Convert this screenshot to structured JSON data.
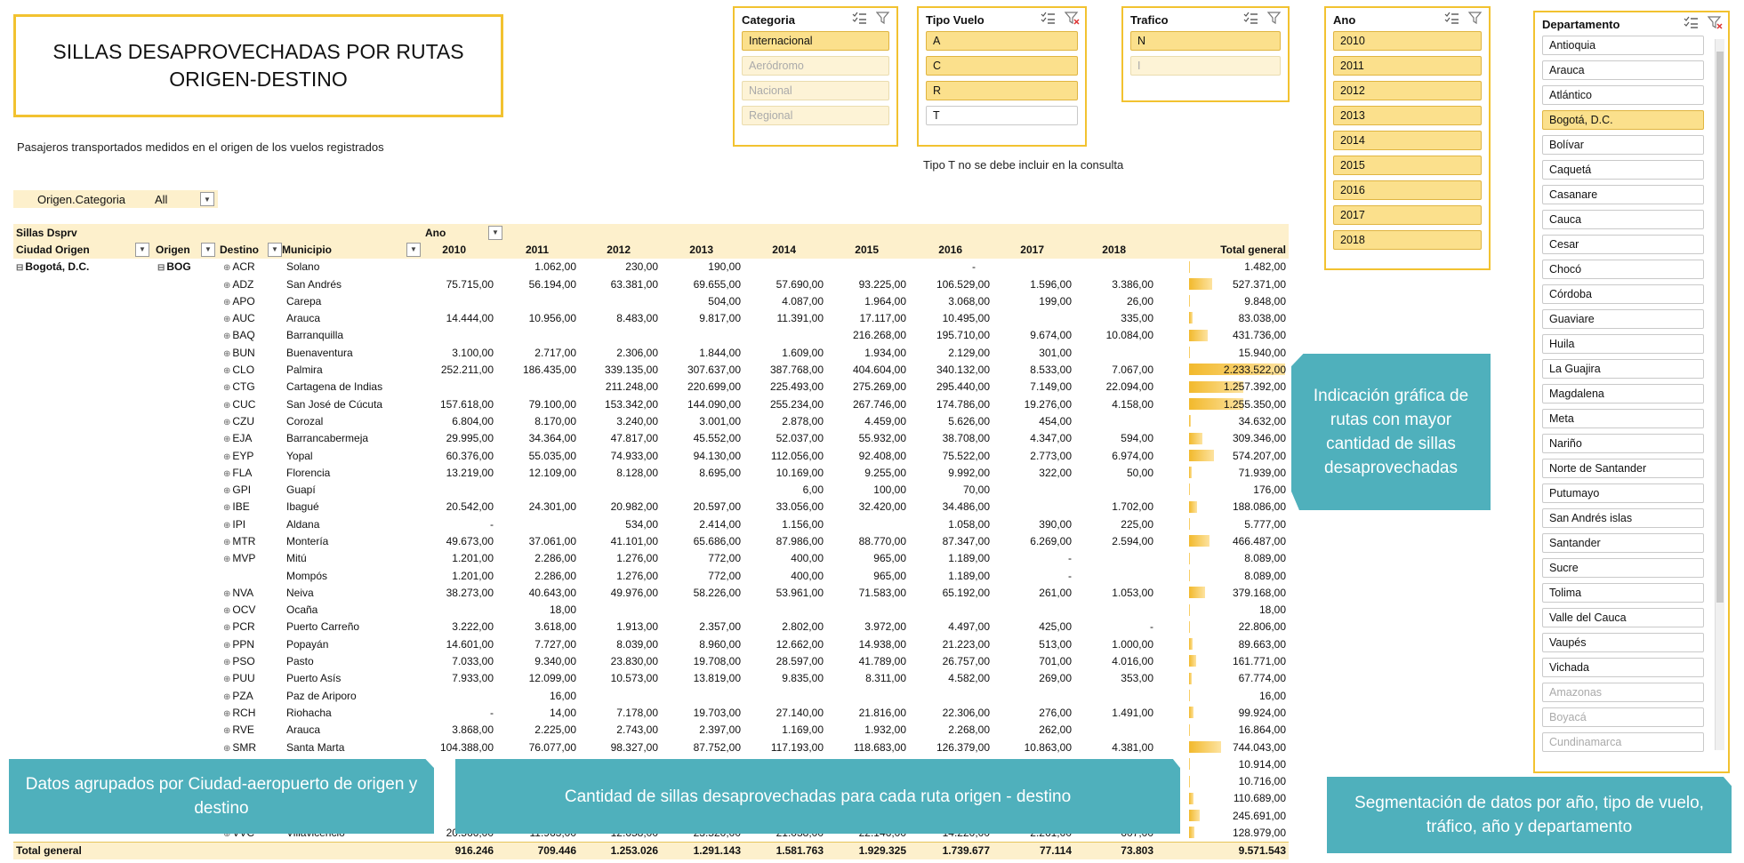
{
  "title": "SILLAS DESAPROVECHADAS POR RUTAS ORIGEN-DESTINO",
  "subtitle": "Pasajeros transportados medidos en el origen de los vuelos registrados",
  "note_tipo": "Tipo T no se debe incluir en la consulta",
  "slicers": {
    "categoria": {
      "title": "Categoria",
      "items": [
        {
          "label": "Internacional",
          "state": "sel"
        },
        {
          "label": "Aeródromo",
          "state": "dim"
        },
        {
          "label": "Nacional",
          "state": "dim"
        },
        {
          "label": "Regional",
          "state": "dim"
        }
      ]
    },
    "tipo_vuelo": {
      "title": "Tipo Vuelo",
      "items": [
        {
          "label": "A",
          "state": "sel"
        },
        {
          "label": "C",
          "state": "sel"
        },
        {
          "label": "R",
          "state": "sel"
        },
        {
          "label": "T",
          "state": ""
        }
      ]
    },
    "trafico": {
      "title": "Trafico",
      "items": [
        {
          "label": "N",
          "state": "sel"
        },
        {
          "label": "I",
          "state": "dim"
        }
      ]
    },
    "ano": {
      "title": "Ano",
      "items": [
        {
          "label": "2010",
          "state": "sel"
        },
        {
          "label": "2011",
          "state": "sel"
        },
        {
          "label": "2012",
          "state": "sel"
        },
        {
          "label": "2013",
          "state": "sel"
        },
        {
          "label": "2014",
          "state": "sel"
        },
        {
          "label": "2015",
          "state": "sel"
        },
        {
          "label": "2016",
          "state": "sel"
        },
        {
          "label": "2017",
          "state": "sel"
        },
        {
          "label": "2018",
          "state": "sel"
        }
      ]
    },
    "departamento": {
      "title": "Departamento",
      "items": [
        {
          "label": "Antioquia",
          "state": ""
        },
        {
          "label": "Arauca",
          "state": ""
        },
        {
          "label": "Atlántico",
          "state": ""
        },
        {
          "label": "Bogotá, D.C.",
          "state": "sel"
        },
        {
          "label": "Bolívar",
          "state": ""
        },
        {
          "label": "Caquetá",
          "state": ""
        },
        {
          "label": "Casanare",
          "state": ""
        },
        {
          "label": "Cauca",
          "state": ""
        },
        {
          "label": "Cesar",
          "state": ""
        },
        {
          "label": "Chocó",
          "state": ""
        },
        {
          "label": "Córdoba",
          "state": ""
        },
        {
          "label": "Guaviare",
          "state": ""
        },
        {
          "label": "Huila",
          "state": ""
        },
        {
          "label": "La Guajira",
          "state": ""
        },
        {
          "label": "Magdalena",
          "state": ""
        },
        {
          "label": "Meta",
          "state": ""
        },
        {
          "label": "Nariño",
          "state": ""
        },
        {
          "label": "Norte de Santander",
          "state": ""
        },
        {
          "label": "Putumayo",
          "state": ""
        },
        {
          "label": "San Andrés islas",
          "state": ""
        },
        {
          "label": "Santander",
          "state": ""
        },
        {
          "label": "Sucre",
          "state": ""
        },
        {
          "label": "Tolima",
          "state": ""
        },
        {
          "label": "Valle del Cauca",
          "state": ""
        },
        {
          "label": "Vaupés",
          "state": ""
        },
        {
          "label": "Vichada",
          "state": ""
        },
        {
          "label": "Amazonas",
          "state": "off"
        },
        {
          "label": "Boyacá",
          "state": "off"
        },
        {
          "label": "Cundinamarca",
          "state": "off"
        }
      ]
    }
  },
  "filter": {
    "label": "Origen.Categoria",
    "value": "All"
  },
  "pivot": {
    "measure": "Sillas Dsprv",
    "col_field": "Ano",
    "headers": [
      "Ciudad Origen",
      "Origen",
      "Destino",
      "Municipio"
    ],
    "years": [
      "2010",
      "2011",
      "2012",
      "2013",
      "2014",
      "2015",
      "2016",
      "2017",
      "2018"
    ],
    "total_label": "Total general",
    "city": "Bogotá, D.C.",
    "origin": "BOG",
    "max_total": 2233522,
    "rows": [
      {
        "d": "ACR",
        "m": "Solano",
        "v": [
          "",
          "1.062,00",
          "230,00",
          "190,00",
          "",
          "",
          "-",
          "",
          ""
        ],
        "t": "1.482,00",
        "n": 1482
      },
      {
        "d": "ADZ",
        "m": "San Andrés",
        "v": [
          "75.715,00",
          "56.194,00",
          "63.381,00",
          "69.655,00",
          "57.690,00",
          "93.225,00",
          "106.529,00",
          "1.596,00",
          "3.386,00"
        ],
        "t": "527.371,00",
        "n": 527371
      },
      {
        "d": "APO",
        "m": "Carepa",
        "v": [
          "",
          "",
          "",
          "504,00",
          "4.087,00",
          "1.964,00",
          "3.068,00",
          "199,00",
          "26,00"
        ],
        "t": "9.848,00",
        "n": 9848
      },
      {
        "d": "AUC",
        "m": "Arauca",
        "v": [
          "14.444,00",
          "10.956,00",
          "8.483,00",
          "9.817,00",
          "11.391,00",
          "17.117,00",
          "10.495,00",
          "",
          "335,00"
        ],
        "t": "83.038,00",
        "n": 83038
      },
      {
        "d": "BAQ",
        "m": "Barranquilla",
        "v": [
          "",
          "",
          "",
          "",
          "",
          "216.268,00",
          "195.710,00",
          "9.674,00",
          "10.084,00"
        ],
        "t": "431.736,00",
        "n": 431736
      },
      {
        "d": "BUN",
        "m": "Buenaventura",
        "v": [
          "3.100,00",
          "2.717,00",
          "2.306,00",
          "1.844,00",
          "1.609,00",
          "1.934,00",
          "2.129,00",
          "301,00",
          ""
        ],
        "t": "15.940,00",
        "n": 15940
      },
      {
        "d": "CLO",
        "m": "Palmira",
        "v": [
          "252.211,00",
          "186.435,00",
          "339.135,00",
          "307.637,00",
          "387.768,00",
          "404.604,00",
          "340.132,00",
          "8.533,00",
          "7.067,00"
        ],
        "t": "2.233.522,00",
        "n": 2233522
      },
      {
        "d": "CTG",
        "m": "Cartagena de Indias",
        "v": [
          "",
          "",
          "211.248,00",
          "220.699,00",
          "225.493,00",
          "275.269,00",
          "295.440,00",
          "7.149,00",
          "22.094,00"
        ],
        "t": "1.257.392,00",
        "n": 1257392
      },
      {
        "d": "CUC",
        "m": "San José de Cúcuta",
        "v": [
          "157.618,00",
          "79.100,00",
          "153.342,00",
          "144.090,00",
          "255.234,00",
          "267.746,00",
          "174.786,00",
          "19.276,00",
          "4.158,00"
        ],
        "t": "1.255.350,00",
        "n": 1255350
      },
      {
        "d": "CZU",
        "m": "Corozal",
        "v": [
          "6.804,00",
          "8.170,00",
          "3.240,00",
          "3.001,00",
          "2.878,00",
          "4.459,00",
          "5.626,00",
          "454,00",
          ""
        ],
        "t": "34.632,00",
        "n": 34632
      },
      {
        "d": "EJA",
        "m": "Barrancabermeja",
        "v": [
          "29.995,00",
          "34.364,00",
          "47.817,00",
          "45.552,00",
          "52.037,00",
          "55.932,00",
          "38.708,00",
          "4.347,00",
          "594,00"
        ],
        "t": "309.346,00",
        "n": 309346
      },
      {
        "d": "EYP",
        "m": "Yopal",
        "v": [
          "60.376,00",
          "55.035,00",
          "74.933,00",
          "94.130,00",
          "112.056,00",
          "92.408,00",
          "75.522,00",
          "2.773,00",
          "6.974,00"
        ],
        "t": "574.207,00",
        "n": 574207
      },
      {
        "d": "FLA",
        "m": "Florencia",
        "v": [
          "13.219,00",
          "12.109,00",
          "8.128,00",
          "8.695,00",
          "10.169,00",
          "9.255,00",
          "9.992,00",
          "322,00",
          "50,00"
        ],
        "t": "71.939,00",
        "n": 71939
      },
      {
        "d": "GPI",
        "m": "Guapí",
        "v": [
          "",
          "",
          "",
          "",
          "6,00",
          "100,00",
          "70,00",
          "",
          ""
        ],
        "t": "176,00",
        "n": 176
      },
      {
        "d": "IBE",
        "m": "Ibagué",
        "v": [
          "20.542,00",
          "24.301,00",
          "20.982,00",
          "20.597,00",
          "33.056,00",
          "32.420,00",
          "34.486,00",
          "",
          "1.702,00"
        ],
        "t": "188.086,00",
        "n": 188086
      },
      {
        "d": "IPI",
        "m": "Aldana",
        "v": [
          "-",
          "",
          "534,00",
          "2.414,00",
          "1.156,00",
          "",
          "1.058,00",
          "390,00",
          "225,00"
        ],
        "t": "5.777,00",
        "n": 5777
      },
      {
        "d": "MTR",
        "m": "Montería",
        "v": [
          "49.673,00",
          "37.061,00",
          "41.101,00",
          "65.686,00",
          "87.986,00",
          "88.770,00",
          "87.347,00",
          "6.269,00",
          "2.594,00"
        ],
        "t": "466.487,00",
        "n": 466487
      },
      {
        "d": "MVP",
        "m": "Mitú",
        "v": [
          "1.201,00",
          "2.286,00",
          "1.276,00",
          "772,00",
          "400,00",
          "965,00",
          "1.189,00",
          "-",
          ""
        ],
        "t": "8.089,00",
        "n": 8089
      },
      {
        "d": "",
        "m": "Mompós",
        "v": [
          "1.201,00",
          "2.286,00",
          "1.276,00",
          "772,00",
          "400,00",
          "965,00",
          "1.189,00",
          "-",
          ""
        ],
        "t": "8.089,00",
        "n": 8089
      },
      {
        "d": "NVA",
        "m": "Neiva",
        "v": [
          "38.273,00",
          "40.643,00",
          "49.976,00",
          "58.226,00",
          "53.961,00",
          "71.583,00",
          "65.192,00",
          "261,00",
          "1.053,00"
        ],
        "t": "379.168,00",
        "n": 379168
      },
      {
        "d": "OCV",
        "m": "Ocaña",
        "v": [
          "",
          "18,00",
          "",
          "",
          "",
          "",
          "",
          "",
          ""
        ],
        "t": "18,00",
        "n": 18
      },
      {
        "d": "PCR",
        "m": "Puerto Carreño",
        "v": [
          "3.222,00",
          "3.618,00",
          "1.913,00",
          "2.357,00",
          "2.802,00",
          "3.972,00",
          "4.497,00",
          "425,00",
          "-"
        ],
        "t": "22.806,00",
        "n": 22806
      },
      {
        "d": "PPN",
        "m": "Popayán",
        "v": [
          "14.601,00",
          "7.727,00",
          "8.039,00",
          "8.960,00",
          "12.662,00",
          "14.938,00",
          "21.223,00",
          "513,00",
          "1.000,00"
        ],
        "t": "89.663,00",
        "n": 89663
      },
      {
        "d": "PSO",
        "m": "Pasto",
        "v": [
          "7.033,00",
          "9.340,00",
          "23.830,00",
          "19.708,00",
          "28.597,00",
          "41.789,00",
          "26.757,00",
          "701,00",
          "4.016,00"
        ],
        "t": "161.771,00",
        "n": 161771
      },
      {
        "d": "PUU",
        "m": "Puerto Asís",
        "v": [
          "7.933,00",
          "12.099,00",
          "10.573,00",
          "13.819,00",
          "9.835,00",
          "8.311,00",
          "4.582,00",
          "269,00",
          "353,00"
        ],
        "t": "67.774,00",
        "n": 67774
      },
      {
        "d": "PZA",
        "m": "Paz de Ariporo",
        "v": [
          "",
          "16,00",
          "",
          "",
          "",
          "",
          "",
          "",
          ""
        ],
        "t": "16,00",
        "n": 16
      },
      {
        "d": "RCH",
        "m": "Riohacha",
        "v": [
          "-",
          "14,00",
          "7.178,00",
          "19.703,00",
          "27.140,00",
          "21.816,00",
          "22.306,00",
          "276,00",
          "1.491,00"
        ],
        "t": "99.924,00",
        "n": 99924
      },
      {
        "d": "RVE",
        "m": "Arauca",
        "v": [
          "3.868,00",
          "2.225,00",
          "2.743,00",
          "2.397,00",
          "1.169,00",
          "1.932,00",
          "2.268,00",
          "262,00",
          ""
        ],
        "t": "16.864,00",
        "n": 16864
      },
      {
        "d": "SMR",
        "m": "Santa Marta",
        "v": [
          "104.388,00",
          "76.077,00",
          "98.327,00",
          "87.752,00",
          "117.193,00",
          "118.683,00",
          "126.379,00",
          "10.863,00",
          "4.381,00"
        ],
        "t": "744.043,00",
        "n": 744043
      },
      {
        "d": "",
        "m": "",
        "v": [
          "",
          "",
          "",
          "",
          "",
          "",
          "",
          "",
          ""
        ],
        "t": "10.914,00",
        "n": 10914
      },
      {
        "d": "",
        "m": "",
        "v": [
          "",
          "",
          "",
          "",
          "",
          "",
          "",
          "",
          ""
        ],
        "t": "10.716,00",
        "n": 10716
      },
      {
        "d": "",
        "m": "",
        "v": [
          "1",
          "",
          "",
          "",
          "",
          "",
          "",
          "",
          ""
        ],
        "t": "110.689,00",
        "n": 110689
      },
      {
        "d": "",
        "m": "",
        "v": [
          "",
          "",
          "",
          "",
          "",
          "",
          "",
          "",
          ""
        ],
        "t": "245.691,00",
        "n": 245691
      },
      {
        "d": "VVC",
        "m": "Villavicencio",
        "v": [
          "20.566,00",
          "11.963,00",
          "12.658,00",
          "23.520,00",
          "21.038,00",
          "22.146,00",
          "14.220,00",
          "2.261,00",
          "607,00"
        ],
        "t": "128.979,00",
        "n": 128979
      }
    ],
    "totals": [
      "916.246",
      "709.446",
      "1.253.026",
      "1.291.143",
      "1.581.763",
      "1.929.325",
      "1.739.677",
      "77.114",
      "73.803"
    ],
    "grand_total": "9.571.543"
  },
  "callouts": {
    "graphic": "Indicación gráfica de rutas con mayor cantidad de sillas desaprovechadas",
    "grouped": "Datos agrupados por Ciudad-aeropuerto de origen y destino",
    "quantity": "Cantidad de sillas desaprovechadas para cada ruta origen - destino",
    "segmentation": "Segmentación de datos por año, tipo de vuelo, tráfico, año y departamento"
  }
}
